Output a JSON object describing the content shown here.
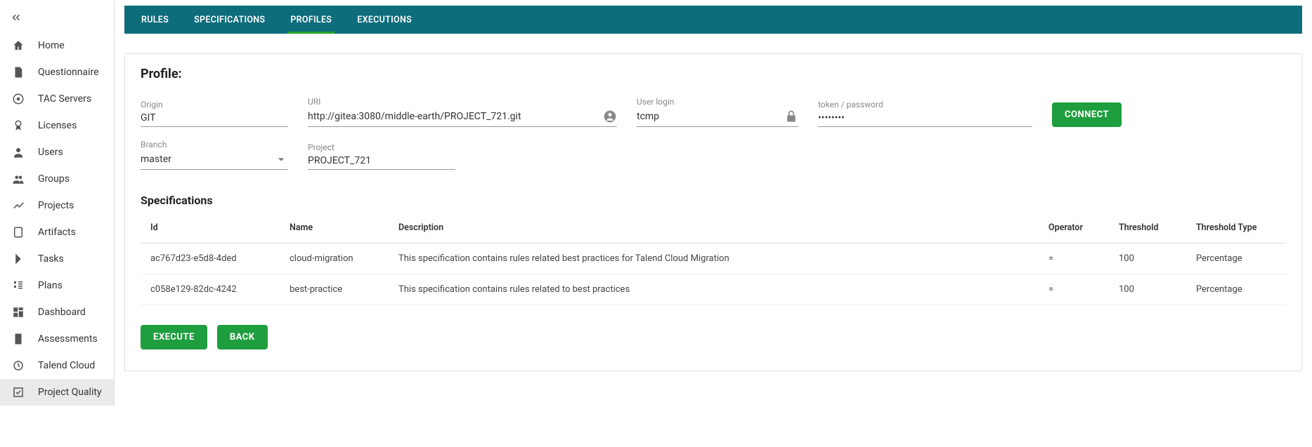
{
  "sidebar": {
    "items": [
      {
        "label": "Home",
        "icon": "home"
      },
      {
        "label": "Questionnaire",
        "icon": "questionnaire"
      },
      {
        "label": "TAC Servers",
        "icon": "tac"
      },
      {
        "label": "Licenses",
        "icon": "license"
      },
      {
        "label": "Users",
        "icon": "user"
      },
      {
        "label": "Groups",
        "icon": "group"
      },
      {
        "label": "Projects",
        "icon": "projects"
      },
      {
        "label": "Artifacts",
        "icon": "artifacts"
      },
      {
        "label": "Tasks",
        "icon": "tasks"
      },
      {
        "label": "Plans",
        "icon": "plans"
      },
      {
        "label": "Dashboard",
        "icon": "dashboard"
      },
      {
        "label": "Assessments",
        "icon": "assessments"
      },
      {
        "label": "Talend Cloud",
        "icon": "cloud"
      },
      {
        "label": "Project Quality",
        "icon": "quality",
        "active": true
      }
    ]
  },
  "tabs": [
    {
      "label": "RULES"
    },
    {
      "label": "SPECIFICATIONS"
    },
    {
      "label": "PROFILES",
      "active": true
    },
    {
      "label": "EXECUTIONS"
    }
  ],
  "profile": {
    "title": "Profile:",
    "fields": {
      "origin": {
        "label": "Origin",
        "value": "GIT"
      },
      "uri": {
        "label": "URI",
        "value": "http://gitea:3080/middle-earth/PROJECT_721.git"
      },
      "login": {
        "label": "User login",
        "value": "tcmp"
      },
      "token": {
        "label": "token / password",
        "value": "••••••••"
      },
      "branch": {
        "label": "Branch",
        "value": "master"
      },
      "project": {
        "label": "Project",
        "value": "PROJECT_721"
      }
    },
    "connect_label": "CONNECT"
  },
  "specifications": {
    "title": "Specifications",
    "columns": [
      "Id",
      "Name",
      "Description",
      "Operator",
      "Threshold",
      "Threshold Type"
    ],
    "rows": [
      {
        "id": "ac767d23-e5d8-4ded",
        "name": "cloud-migration",
        "description": "This specification contains rules related best practices for Talend Cloud Migration",
        "operator": "=",
        "threshold": "100",
        "threshold_type": "Percentage"
      },
      {
        "id": "c058e129-82dc-4242",
        "name": "best-practice",
        "description": "This specification contains rules related to best practices",
        "operator": "=",
        "threshold": "100",
        "threshold_type": "Percentage"
      }
    ]
  },
  "actions": {
    "execute": "EXECUTE",
    "back": "BACK"
  }
}
